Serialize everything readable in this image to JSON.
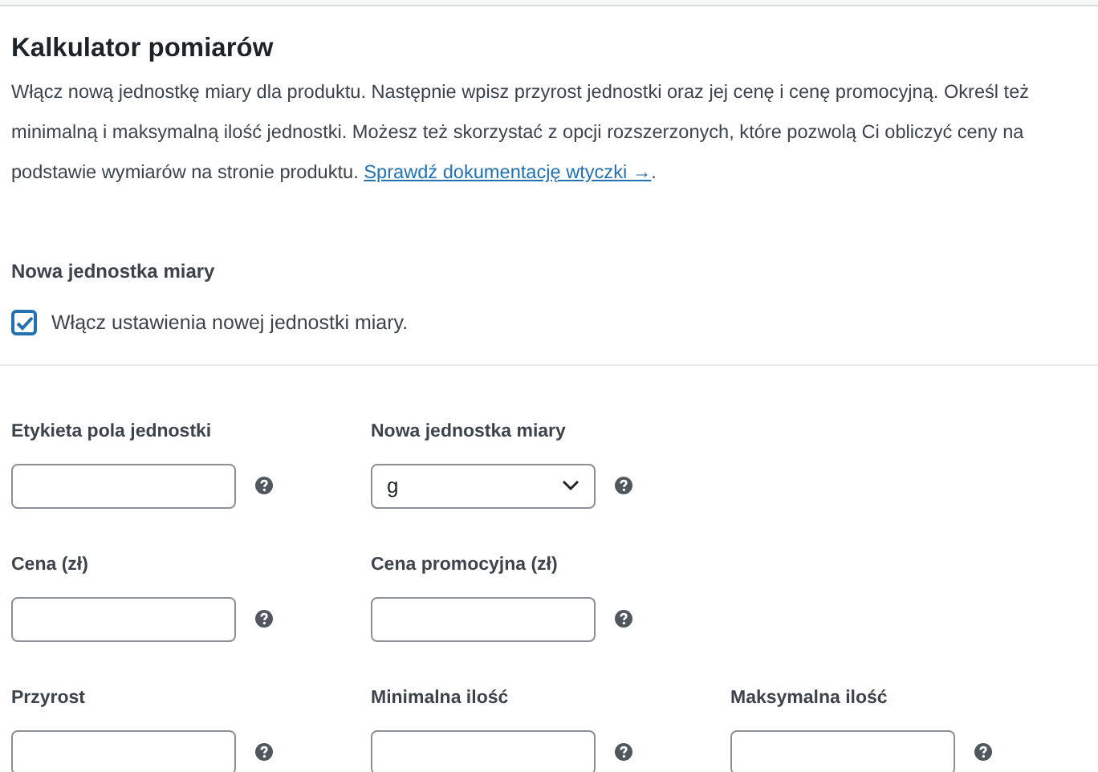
{
  "title": "Kalkulator pomiarów",
  "description": {
    "text": "Włącz nową jednostkę miary dla produktu. Następnie wpisz przyrost jednostki oraz jej cenę i cenę promocyjną. Określ też minimalną i maksymalną ilość jednostki. Możesz też skorzystać z opcji rozszerzonych, które pozwolą Ci obliczyć ceny na podstawie wymiarów na stronie produktu.",
    "link": "Sprawdź dokumentację wtyczki →",
    "after": "."
  },
  "section": {
    "title": "Nowa jednostka miary",
    "checkbox": {
      "label": "Włącz ustawienia nowej jednostki miary.",
      "checked": true
    }
  },
  "rows": [
    [
      {
        "label": "Etykieta pola jednostki",
        "kind": "text"
      },
      {
        "label": "Nowa jednostka miary",
        "kind": "select",
        "value": "g"
      }
    ],
    [
      {
        "label": "Cena (zł)",
        "kind": "text"
      },
      {
        "label": "Cena promocyjna (zł)",
        "kind": "text"
      }
    ],
    [
      {
        "label": "Przyrost",
        "kind": "text"
      },
      {
        "label": "Minimalna ilość",
        "kind": "text"
      },
      {
        "label": "Maksymalna ilość",
        "kind": "text"
      }
    ]
  ]
}
